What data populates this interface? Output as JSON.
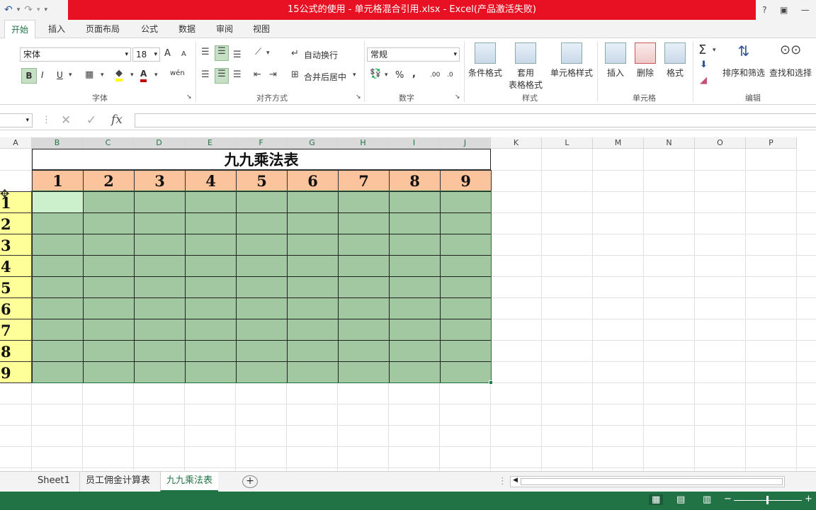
{
  "window": {
    "title": "15公式的使用 - 单元格混合引用.xlsx -   Excel(产品激活失败)",
    "help": "?",
    "minimize": "—"
  },
  "quick_access": {
    "undo": "↶",
    "redo": "↷"
  },
  "ribbon_tabs": [
    "开始",
    "插入",
    "页面布局",
    "公式",
    "数据",
    "审阅",
    "视图"
  ],
  "font_group": {
    "font_name": "宋体",
    "font_size": "18",
    "grow": "A",
    "shrink": "A",
    "bold": "B",
    "italic": "I",
    "underline": "U",
    "font_color": "A",
    "phonetic": "wén",
    "label": "字体"
  },
  "alignment_group": {
    "wrap": "自动换行",
    "merge": "合并后居中",
    "label": "对齐方式"
  },
  "number_group": {
    "format": "常规",
    "percent": "%",
    "comma": ",",
    "inc_dec": ".00",
    "dec_dec": ".0",
    "label": "数字"
  },
  "styles_group": {
    "conditional": "条件格式",
    "table_format_1": "套用",
    "table_format_2": "表格格式",
    "cell_styles": "单元格样式",
    "label": "样式"
  },
  "cells_group": {
    "insert": "插入",
    "delete": "删除",
    "format": "格式",
    "label": "单元格"
  },
  "editing_group": {
    "sum": "Σ",
    "sort_filter": "排序和筛选",
    "find_select": "查找和选择",
    "label": "编辑"
  },
  "formula_bar": {
    "fx": "fx",
    "cancel": "✕",
    "enter": "✓",
    "value": ""
  },
  "columns": [
    "A",
    "B",
    "C",
    "D",
    "E",
    "F",
    "G",
    "H",
    "I",
    "J",
    "K",
    "L",
    "M",
    "N",
    "O",
    "P"
  ],
  "sheet_title": "九九乘法表",
  "header_row": [
    "1",
    "2",
    "3",
    "4",
    "5",
    "6",
    "7",
    "8",
    "9"
  ],
  "row_labels": [
    "1",
    "2",
    "3",
    "4",
    "5",
    "6",
    "7",
    "8",
    "9"
  ],
  "sheet_tabs": [
    "Sheet1",
    "员工佣金计算表",
    "九九乘法表"
  ],
  "active_sheet": "九九乘法表",
  "add_sheet": "+",
  "colors": {
    "excel_green": "#217346",
    "title_red": "#e81123",
    "header_fill": "#fcc49c",
    "label_fill": "#ffff99",
    "selection_fill": "#a1c8a0",
    "active_cell": "#ccf0cc"
  }
}
